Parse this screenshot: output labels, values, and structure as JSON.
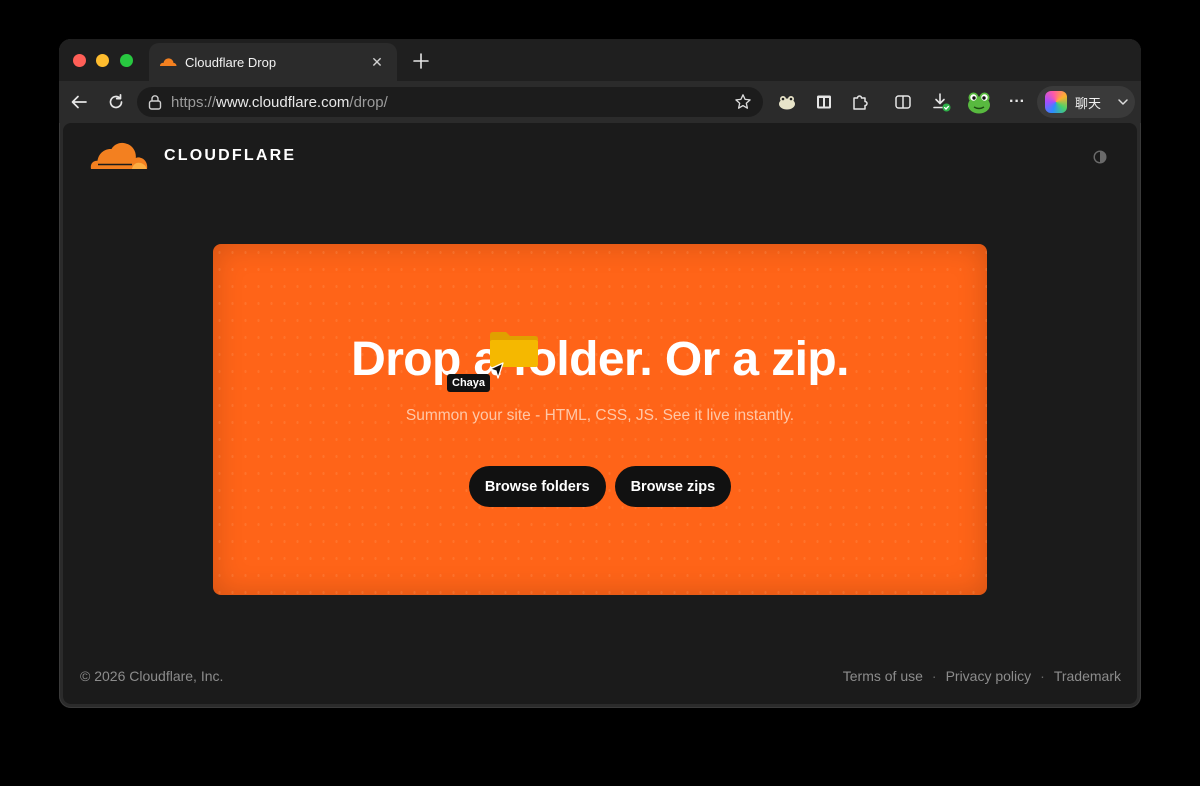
{
  "tab": {
    "title": "Cloudflare Drop",
    "close_glyph": "✕"
  },
  "toolbar": {
    "url_scheme": "https://",
    "url_host": "www.cloudflare.com",
    "url_path": "/drop/",
    "copilot_label": "聊天",
    "more_glyph": "···"
  },
  "page": {
    "brand": "CLOUDFLARE",
    "hero_title": "Drop a folder. Or a zip.",
    "hero_subtitle": "Summon your site - HTML, CSS, JS. See it live instantly.",
    "buttons": [
      "Browse folders",
      "Browse zips"
    ],
    "drag_tag": "Chaya"
  },
  "footer": {
    "copyright": "© 2026 Cloudflare, Inc.",
    "links": [
      "Terms of use",
      "Privacy policy",
      "Trademark"
    ],
    "separator": "·"
  },
  "colors": {
    "brand_orange": "#ff6418",
    "page_bg": "#1b1b1b"
  },
  "icons": [
    "back-icon",
    "reload-icon",
    "lock-icon",
    "star-icon",
    "extension-frog-icon",
    "reading-view-icon",
    "puzzle-icon",
    "split-screen-icon",
    "downloads-icon",
    "frog-avatar-icon",
    "more-icon",
    "copilot-icon",
    "chevron-down-icon",
    "theme-toggle-icon",
    "folder-icon",
    "cursor-icon"
  ]
}
